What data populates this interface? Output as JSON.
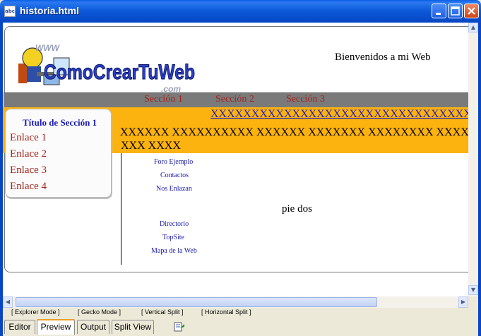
{
  "window": {
    "title": "historia.html",
    "app_icon_glyph": "abc"
  },
  "page": {
    "welcome": "Bienvenidos a mi Web",
    "logo_text": "ComoCrearTuWeb",
    "logo_sub": ".com",
    "logo_top": "WWW",
    "nav": [
      "Sección 1",
      "Sección 2",
      "Sección 3"
    ],
    "orange_link": "XXXXXXXXXXXXXXXXXXXXXXXXXXXXXXXXX",
    "orange_text_line1": "XXXXXX XXXXXXXXXX XXXXXX XXXXXXX XXXXXXXX XXXX",
    "orange_text_line2": "XXX XXXX",
    "sidebar_title": "Título de Sección 1",
    "sidebar_links": [
      "Enlace 1",
      "Enlace 2",
      "Enlace 3",
      "Enlace 4"
    ],
    "links_top": [
      "Foro Ejemplo",
      "Contactos",
      "Nos Enlazan"
    ],
    "footer_text": "pie dos",
    "links_bottom": [
      "Directorio",
      "TopSite",
      "Mapa de la Web"
    ]
  },
  "modes": [
    "[ Explorer Mode ]",
    "[ Gecko Mode ]",
    "[ Vertical Split ]",
    "[ Horizontal Split ]"
  ],
  "tabs": [
    {
      "label": "Editor",
      "active": false
    },
    {
      "label": "Preview",
      "active": true
    },
    {
      "label": "Output",
      "active": false
    },
    {
      "label": "Split View",
      "active": false
    }
  ],
  "colors": {
    "link_red": "#a3241c",
    "link_blue": "#1a1aa8",
    "orange": "#fcb20f",
    "navbar": "#7a7a7a",
    "xp_blue": "#0a58d8"
  },
  "icons": [
    "minimize-icon",
    "maximize-icon",
    "close-icon",
    "scroll-up-icon",
    "scroll-down-icon",
    "scroll-left-icon",
    "scroll-right-icon",
    "tool-icon"
  ]
}
